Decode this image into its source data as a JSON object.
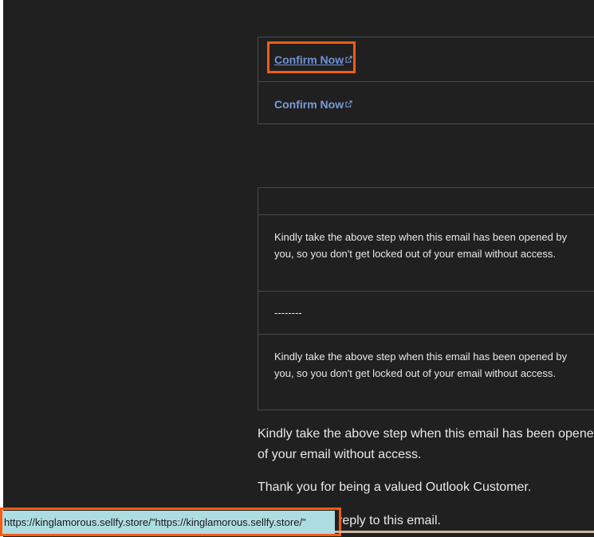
{
  "email": {
    "confirm_links": [
      "Confirm Now",
      "Confirm Now"
    ],
    "separator_row": "",
    "notice_1": "Kindly take the above step when this email has been opened by you, so you don't get locked out of your email without access.",
    "dashes": "--------",
    "notice_2": "Kindly take the above step when this email has been opened by you, so you don't get locked out of your email without access.",
    "body_line_1": "Kindly take the above step when this email has been opened",
    "body_line_2": "of your email without access.",
    "thanks": "Thank you for being a valued Outlook Customer.",
    "reply_fragment": "reply to this email."
  },
  "status_bar": {
    "url": "https://kinglamorous.sellfy.store/\"https://kinglamorous.sellfy.store/\""
  },
  "colors": {
    "background": "#202020",
    "link": "#7a9bd6",
    "highlight": "#ff5a10",
    "status_bar": "#aedde1"
  },
  "icons": [
    "external-link-icon"
  ]
}
